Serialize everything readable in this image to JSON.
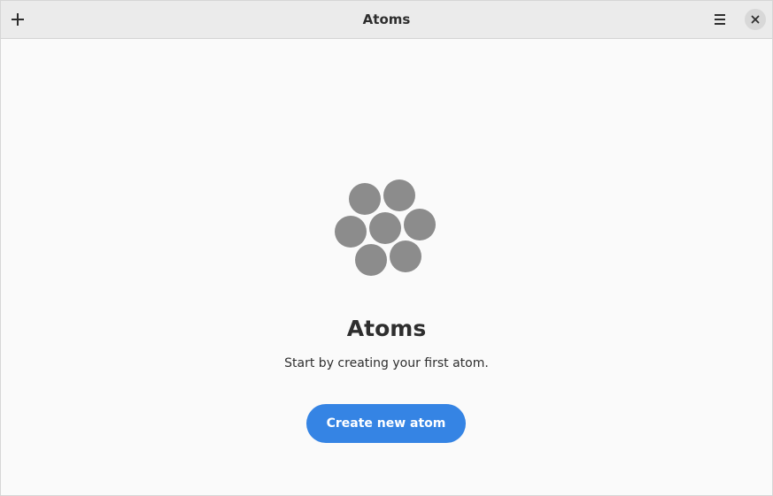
{
  "window": {
    "title": "Atoms"
  },
  "headerbar": {
    "add_icon": "plus-icon",
    "menu_icon": "hamburger-menu-icon",
    "close_icon": "close-icon"
  },
  "status_page": {
    "icon": "atoms-icon",
    "title": "Atoms",
    "description": "Start by creating your first atom.",
    "button_label": "Create new atom"
  },
  "colors": {
    "accent": "#3584e4",
    "icon_gray": "#8c8c8c",
    "headerbar_bg": "#ebebeb",
    "content_bg": "#fafafa"
  }
}
